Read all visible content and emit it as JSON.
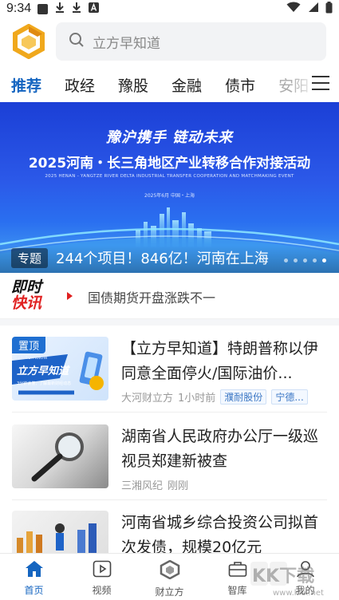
{
  "status_bar": {
    "time": "9:34"
  },
  "search": {
    "placeholder": "立方早知道"
  },
  "tabs": [
    {
      "label": "推荐",
      "active": true
    },
    {
      "label": "政经"
    },
    {
      "label": "豫股"
    },
    {
      "label": "金融"
    },
    {
      "label": "债市"
    },
    {
      "label": "安阳"
    }
  ],
  "banner": {
    "slogan": "豫沪携手 链动未来",
    "title": "2025河南・长三角地区产业转移合作对接活动",
    "subtitle": "2025 HENAN - YANGTZE RIVER DELTA INDUSTRIAL TRANSFER COOPERATION AND MATCHMAKING EVENT",
    "date": "2025年6月  中国・上海",
    "tag": "专题",
    "caption": "244个项目！846亿！河南在上海"
  },
  "flash": {
    "logo_line1": "即时",
    "logo_line2": "快讯",
    "text": "国债期货开盘涨跌不一"
  },
  "news": [
    {
      "badge": "置顶",
      "thumb_text": "立方早知道",
      "thumb_small": "EARLIER KNOW",
      "thumb_sub": "3分钟读懂，了解最新财经动态",
      "title": "【立方早知道】特朗普称以伊同意全面停火/国际油价...",
      "source": "大河财立方",
      "time": "1小时前",
      "tags": [
        "濮耐股份",
        "宁德..."
      ]
    },
    {
      "title": "湖南省人民政府办公厅一级巡视员郑建新被查",
      "source": "三湘风纪",
      "time": "刚刚"
    },
    {
      "title": "河南省城乡综合投资公司拟首次发债，规模20亿元"
    }
  ],
  "bottom_nav": [
    {
      "label": "首页",
      "active": true,
      "icon": "home-icon"
    },
    {
      "label": "视频",
      "icon": "video-icon"
    },
    {
      "label": "财立方",
      "icon": "cube-logo-icon"
    },
    {
      "label": "智库",
      "icon": "briefcase-icon"
    },
    {
      "label": "我的",
      "icon": "user-icon"
    }
  ],
  "watermark": {
    "text": "KK下载",
    "url": "www.kkx.net"
  },
  "colors": {
    "accent": "#1565c0",
    "flash_red": "#e02020"
  }
}
